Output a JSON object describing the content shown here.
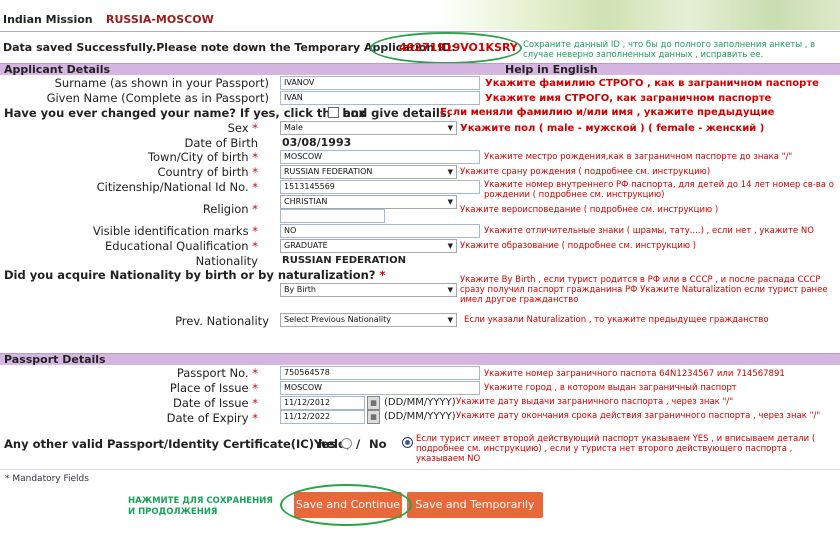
{
  "header": {
    "mission_label": "Indian Mission",
    "mission_value": "RUSSIA-MOSCOW"
  },
  "notice": {
    "saved_text": "Data saved Successfully.Please note down the Temporary Application ID:",
    "app_id": "49271919VO1KSRY",
    "ru_hint": "Сохраните данный ID , что бы до полного заполнения анкеты , в случае неверно заполненных данных , исправить ее."
  },
  "applicant": {
    "section_title": "Applicant Details",
    "help_text": "Help in English",
    "surname": {
      "label": "Surname (as shown in your Passport)",
      "value": "IVANOV",
      "hint": "Укажите фамилию СТРОГО , как в заграничном паспорте"
    },
    "given_name": {
      "label": "Given Name (Complete as in Passport)",
      "value": "IVAN",
      "hint": "Укажите имя СТРОГО, как заграничном паспорте"
    },
    "changed_name": {
      "question": "Have you ever changed your name? If yes, click the box",
      "suffix": "and give details.",
      "hint": "Если меняли фамилию и/или имя , укажите предыдущие"
    },
    "sex": {
      "label": "Sex",
      "value": "Male",
      "hint": "Укажите пол ( male - мужской ) ( female - женский )"
    },
    "dob": {
      "label": "Date of Birth",
      "value": "03/08/1993"
    },
    "birth_town": {
      "label": "Town/City of birth",
      "value": "MOSCOW",
      "hint": "Укажите местро рождения,как в заграничном паспорте до знака \"/\""
    },
    "birth_country": {
      "label": "Country of birth",
      "value": "RUSSIAN FEDERATION",
      "hint": "Укажите срану рождения ( подробнее см. инструкцию)"
    },
    "citizenship_id": {
      "label": "Citizenship/National Id No.",
      "value": "1513145569",
      "hint": "Укажите номер внутреннего РФ паспорта, для детей до 14 лет номер св-ва о рождении ( подробнее см. инструкцию)"
    },
    "religion": {
      "label": "Religion",
      "value": "CHRISTIAN",
      "other_value": "",
      "hint": "Укажите вероисповедание ( подробнее см. инструкцию )"
    },
    "marks": {
      "label": "Visible identification marks",
      "value": "NO",
      "hint": "Укажите отличительные знаки ( шрамы, тату....) , если нет , укажите NO"
    },
    "education": {
      "label": "Educational Qualification",
      "value": "GRADUATE",
      "hint": "Укажите образование ( подробнее см. инструкцию )"
    },
    "nationality": {
      "label": "Nationality",
      "value": "RUSSIAN FEDERATION"
    },
    "acquire": {
      "question": "Did you acquire Nationality by birth or by naturalization?",
      "value": "By Birth",
      "hint": "Укажите By Birth , если турист родится в РФ или в СССР , и после распада СССР сразу получил паспорт гражданина РФ Укажите Naturalization если турист ранее имел другое гражданство"
    },
    "prev_nationality": {
      "label": "Prev. Nationality",
      "value": "Select Previous Nationality",
      "hint": "Если указали Naturalization , то укажите предыдущее гражданство"
    }
  },
  "passport": {
    "section_title": "Passport Details",
    "number": {
      "label": "Passport No.",
      "value": "750564578",
      "hint": "Укажите номер заграничного паспота 64N1234567 или 714567891"
    },
    "place": {
      "label": "Place of Issue",
      "value": "MOSCOW",
      "hint": "Укажите город , в котором выдан заграничный паспорт"
    },
    "issue_date": {
      "label": "Date of Issue",
      "value": "11/12/2012",
      "format": "(DD/MM/YYYY)",
      "hint": "Укажите дату выдачи заграничного паспорта , через знак \"/\""
    },
    "expiry_date": {
      "label": "Date of Expiry",
      "value": "11/12/2022",
      "format": "(DD/MM/YYYY)",
      "hint": "Укажите дату окончания срока действия заграничного паспорта , через знак \"/\""
    },
    "other_passport": {
      "question": "Any other valid Passport/Identity Certificate(IC) held,",
      "yes": "Yes",
      "no": "No",
      "slash": "/",
      "hint": "Если турист имеет второй действующий паспорт указываем YES , и вписываем детали ( подробнее см. инструкцию) , если у туриста нет второго действующего паспорта , указываем NO"
    }
  },
  "footer": {
    "mandatory": "* Mandatory Fields",
    "ru_save": "НАЖМИТЕ ДЛЯ СОХРАНЕНИЯ И ПРОДОЛЖЕНИЯ",
    "save_continue": "Save and Continue",
    "save_exit": "Save and Temporarily Exit"
  },
  "colors": {
    "accent_red": "#d40000",
    "green": "#2ca24b",
    "button": "#e8683a",
    "section": "#d5b6e0"
  }
}
